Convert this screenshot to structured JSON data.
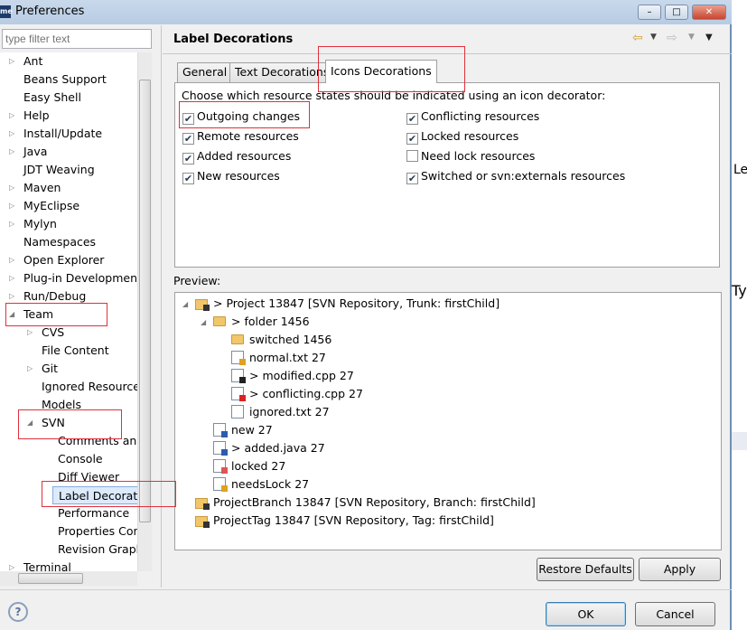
{
  "window": {
    "title": "Preferences",
    "app_icon_text": "me"
  },
  "left": {
    "filter_placeholder": "type filter text",
    "tree": [
      {
        "label": "Ant",
        "level": 0,
        "twisty": "collapsed"
      },
      {
        "label": "Beans Support",
        "level": 0,
        "twisty": "none"
      },
      {
        "label": "Easy Shell",
        "level": 0,
        "twisty": "none"
      },
      {
        "label": "Help",
        "level": 0,
        "twisty": "collapsed"
      },
      {
        "label": "Install/Update",
        "level": 0,
        "twisty": "collapsed"
      },
      {
        "label": "Java",
        "level": 0,
        "twisty": "collapsed"
      },
      {
        "label": "JDT Weaving",
        "level": 0,
        "twisty": "none"
      },
      {
        "label": "Maven",
        "level": 0,
        "twisty": "collapsed"
      },
      {
        "label": "MyEclipse",
        "level": 0,
        "twisty": "collapsed"
      },
      {
        "label": "Mylyn",
        "level": 0,
        "twisty": "collapsed"
      },
      {
        "label": "Namespaces",
        "level": 0,
        "twisty": "none"
      },
      {
        "label": "Open Explorer",
        "level": 0,
        "twisty": "collapsed"
      },
      {
        "label": "Plug-in Development",
        "level": 0,
        "twisty": "collapsed"
      },
      {
        "label": "Run/Debug",
        "level": 0,
        "twisty": "collapsed"
      },
      {
        "label": "Team",
        "level": 0,
        "twisty": "expanded"
      },
      {
        "label": "CVS",
        "level": 1,
        "twisty": "collapsed"
      },
      {
        "label": "File Content",
        "level": 1,
        "twisty": "none"
      },
      {
        "label": "Git",
        "level": 1,
        "twisty": "collapsed"
      },
      {
        "label": "Ignored Resources",
        "level": 1,
        "twisty": "none"
      },
      {
        "label": "Models",
        "level": 1,
        "twisty": "none"
      },
      {
        "label": "SVN",
        "level": 1,
        "twisty": "expanded"
      },
      {
        "label": "Comments and Templates",
        "level": 2,
        "twisty": "none"
      },
      {
        "label": "Console",
        "level": 2,
        "twisty": "none"
      },
      {
        "label": "Diff Viewer",
        "level": 2,
        "twisty": "none"
      },
      {
        "label": "Label Decorations",
        "level": 2,
        "twisty": "none",
        "selected": true
      },
      {
        "label": "Performance",
        "level": 2,
        "twisty": "none"
      },
      {
        "label": "Properties Configuration",
        "level": 2,
        "twisty": "none"
      },
      {
        "label": "Revision Graph",
        "level": 2,
        "twisty": "none"
      },
      {
        "label": "Terminal",
        "level": 0,
        "twisty": "collapsed"
      }
    ]
  },
  "page": {
    "title": "Label Decorations",
    "tabs": [
      {
        "label": "General"
      },
      {
        "label": "Text Decorations"
      },
      {
        "label": "Icons Decorations",
        "active": true
      }
    ],
    "instruction": "Choose which resource states should be indicated using an icon decorator:",
    "checkboxes": [
      {
        "label": "Outgoing changes",
        "checked": true
      },
      {
        "label": "Remote resources",
        "checked": true
      },
      {
        "label": "Added resources",
        "checked": true
      },
      {
        "label": "New resources",
        "checked": true
      },
      {
        "label": "Conflicting resources",
        "checked": true
      },
      {
        "label": "Locked resources",
        "checked": true
      },
      {
        "label": "Need lock resources",
        "checked": false
      },
      {
        "label": "Switched or svn:externals resources",
        "checked": true
      }
    ],
    "preview_label": "Preview:",
    "preview": [
      {
        "label": "> Project 13847 [SVN Repository, Trunk: firstChild]",
        "level": 0,
        "icon": "project-icon",
        "twisty": "expanded"
      },
      {
        "label": "> folder 1456",
        "level": 1,
        "icon": "folder-icon",
        "twisty": "expanded"
      },
      {
        "label": "switched 1456",
        "level": 2,
        "icon": "switched-folder-icon"
      },
      {
        "label": "normal.txt 27",
        "level": 2,
        "icon": "file-icon"
      },
      {
        "label": "> modified.cpp 27",
        "level": 2,
        "icon": "modified-file-icon"
      },
      {
        "label": "> conflicting.cpp 27",
        "level": 2,
        "icon": "conflict-file-icon"
      },
      {
        "label": "ignored.txt 27",
        "level": 2,
        "icon": "ignored-file-icon"
      },
      {
        "label": "new 27",
        "level": 1,
        "icon": "new-file-icon"
      },
      {
        "label": "> added.java 27",
        "level": 1,
        "icon": "added-file-icon"
      },
      {
        "label": "locked 27",
        "level": 1,
        "icon": "locked-file-icon"
      },
      {
        "label": "needsLock 27",
        "level": 1,
        "icon": "needs-lock-file-icon"
      },
      {
        "label": "ProjectBranch 13847 [SVN Repository, Branch: firstChild]",
        "level": 0,
        "icon": "project-icon"
      },
      {
        "label": "ProjectTag 13847 [SVN Repository, Tag: firstChild]",
        "level": 0,
        "icon": "project-icon"
      }
    ],
    "restore_defaults": "Restore Defaults",
    "apply": "Apply"
  },
  "footer": {
    "ok": "OK",
    "cancel": "Cancel",
    "help_icon": "?"
  },
  "colors": {
    "annotation": "#e0303a",
    "selection": "#dceafc"
  }
}
